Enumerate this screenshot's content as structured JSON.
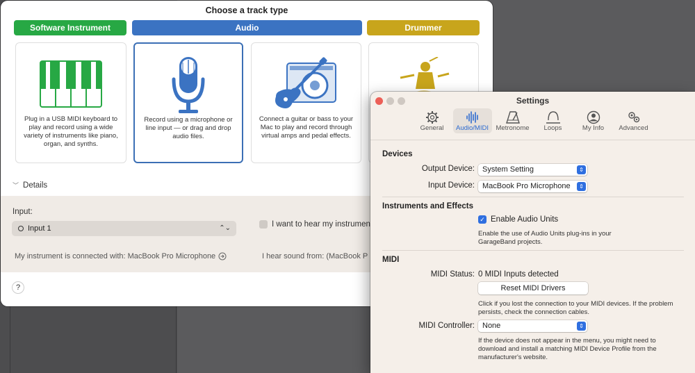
{
  "track_dialog": {
    "title": "Choose a track type",
    "categories": [
      {
        "label": "Software Instrument",
        "color": "#27a844"
      },
      {
        "label": "Audio",
        "color": "#3b73c2"
      },
      {
        "label": "Drummer",
        "color": "#c8a51c"
      }
    ],
    "cards": [
      {
        "icon": "piano-keyboard-icon",
        "description": "Plug in a USB MIDI keyboard to play and record using a wide variety of instruments like piano, organ, and synths."
      },
      {
        "icon": "microphone-icon",
        "description": "Record using a microphone or line input — or drag and drop audio files."
      },
      {
        "icon": "guitar-amp-icon",
        "description": "Connect a guitar or bass to your Mac to play and record through virtual amps and pedal effects."
      },
      {
        "icon": "drummer-icon",
        "description": ""
      }
    ],
    "details_label": "Details",
    "input_label": "Input:",
    "input_value": "Input 1",
    "hear_checkbox_label": "I want to hear my instrument",
    "connected_text": "My instrument is connected with: MacBook Pro Microphone",
    "hear_from_text": "I hear sound from: (MacBook P",
    "help_label": "?"
  },
  "settings": {
    "title": "Settings",
    "tabs": [
      {
        "label": "General",
        "icon": "gear-icon"
      },
      {
        "label": "Audio/MIDI",
        "icon": "waveform-icon",
        "active": true
      },
      {
        "label": "Metronome",
        "icon": "metronome-icon"
      },
      {
        "label": "Loops",
        "icon": "loops-icon"
      },
      {
        "label": "My Info",
        "icon": "person-icon"
      },
      {
        "label": "Advanced",
        "icon": "gears-icon"
      }
    ],
    "devices": {
      "heading": "Devices",
      "output_label": "Output Device:",
      "output_value": "System Setting",
      "input_label": "Input Device:",
      "input_value": "MacBook Pro Microphone"
    },
    "instruments": {
      "heading": "Instruments and Effects",
      "enable_label": "Enable Audio Units",
      "enable_desc_1": "Enable the use of Audio Units plug-ins in your",
      "enable_desc_2": "GarageBand projects."
    },
    "midi": {
      "heading": "MIDI",
      "status_label": "MIDI Status:",
      "status_value": "0 MIDI Inputs detected",
      "reset_button": "Reset MIDI Drivers",
      "reset_desc_1": "Click if you lost the connection to your MIDI devices. If the problem",
      "reset_desc_2": "persists, check the connection cables.",
      "controller_label": "MIDI Controller:",
      "controller_value": "None",
      "controller_desc_1": "If the device does not appear in the menu, you might need to",
      "controller_desc_2": "download and install a matching MIDI Device Profile from the",
      "controller_desc_3": "manufacturer's website."
    }
  }
}
